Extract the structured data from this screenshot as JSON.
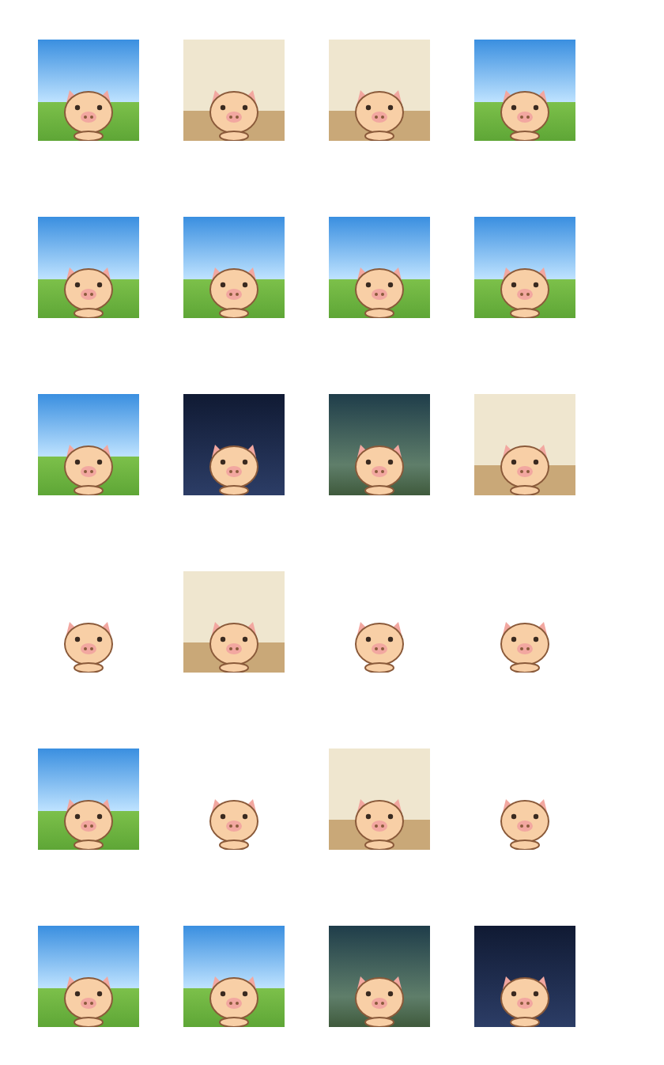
{
  "stickers": [
    {
      "kind": "sky"
    },
    {
      "kind": "indoor"
    },
    {
      "kind": "indoor"
    },
    {
      "kind": "sky"
    },
    {
      "kind": "sky"
    },
    {
      "kind": "sky"
    },
    {
      "kind": "sky"
    },
    {
      "kind": "sky"
    },
    {
      "kind": "sky"
    },
    {
      "kind": "night"
    },
    {
      "kind": "dusk"
    },
    {
      "kind": "indoor"
    },
    {
      "kind": "plain"
    },
    {
      "kind": "indoor"
    },
    {
      "kind": "plain"
    },
    {
      "kind": "plain"
    },
    {
      "kind": "sky"
    },
    {
      "kind": "plain"
    },
    {
      "kind": "indoor"
    },
    {
      "kind": "plain"
    },
    {
      "kind": "sky"
    },
    {
      "kind": "sky"
    },
    {
      "kind": "dusk"
    },
    {
      "kind": "night"
    }
  ]
}
